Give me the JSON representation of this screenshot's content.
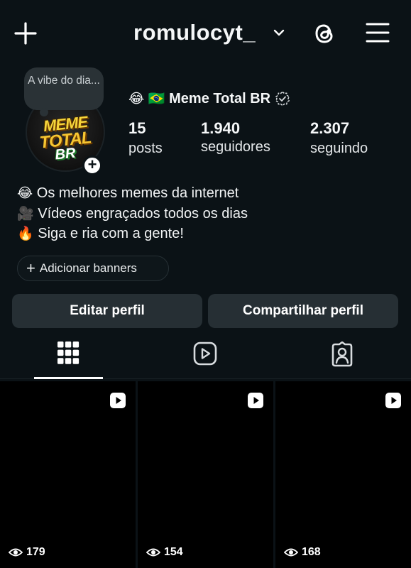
{
  "header": {
    "username": "romulocyt_",
    "icons": [
      "plus-icon",
      "chevron-down-icon",
      "threads-icon",
      "menu-icon"
    ]
  },
  "note": {
    "text": "A vibe do dia..."
  },
  "avatar": {
    "logo_line1": "MEME",
    "logo_line2": "TOTAL",
    "logo_line3": "BR"
  },
  "profile": {
    "name_emoji": "😂 🇧🇷",
    "name": "Meme Total BR"
  },
  "stats": [
    {
      "value": "15",
      "label": "posts"
    },
    {
      "value": "1.940",
      "label": "seguidores"
    },
    {
      "value": "2.307",
      "label": "seguindo"
    }
  ],
  "bio": [
    {
      "emoji": "😂",
      "text": "Os melhores memes da internet"
    },
    {
      "emoji": "🎥",
      "text": "Vídeos engraçados todos os dias"
    },
    {
      "emoji": "🔥",
      "text": "Siga e ria com a gente!"
    }
  ],
  "banner_chip": {
    "label": "Adicionar banners"
  },
  "buttons": {
    "edit": "Editar perfil",
    "share": "Compartilhar perfil"
  },
  "tabs": [
    "grid-icon",
    "reels-icon",
    "tagged-icon"
  ],
  "grid": [
    {
      "views": "179"
    },
    {
      "views": "154"
    },
    {
      "views": "168"
    }
  ],
  "colors": {
    "background": "#0b1216",
    "button": "#262f34",
    "text": "#f5f7f8"
  }
}
